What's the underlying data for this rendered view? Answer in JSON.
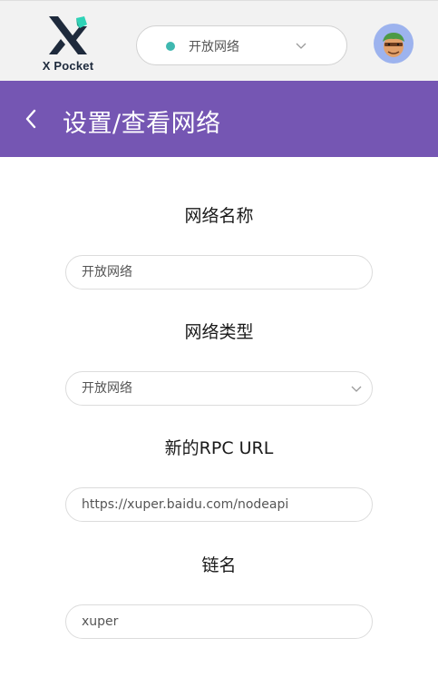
{
  "topbar": {
    "logo_text": "X Pocket",
    "logo_icon": "x-pocket-logo",
    "network_selector": {
      "label": "开放网络",
      "status_color": "#3fb8b0",
      "icon": "chevron-down-icon"
    },
    "avatar_icon": "avatar"
  },
  "header": {
    "title": "设置/查看网络",
    "back_icon": "chevron-left-icon",
    "background": "#7556b3"
  },
  "form": {
    "network_name": {
      "label": "网络名称",
      "value": "开放网络"
    },
    "network_type": {
      "label": "网络类型",
      "value": "开放网络",
      "icon": "chevron-down-icon"
    },
    "rpc_url": {
      "label": "新的RPC URL",
      "value": "https://xuper.baidu.com/nodeapi"
    },
    "chain_name": {
      "label": "链名",
      "value": "xuper"
    }
  }
}
